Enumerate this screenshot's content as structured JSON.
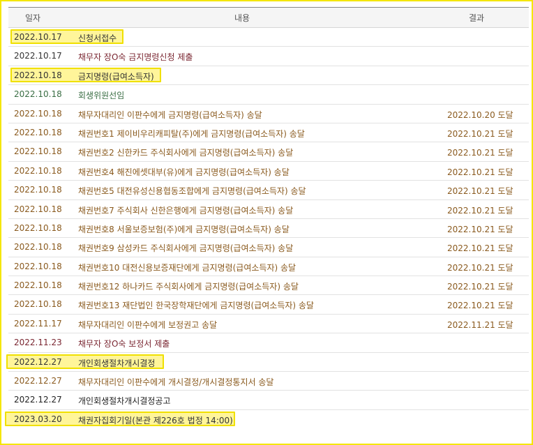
{
  "header": {
    "date": "일자",
    "content": "내용",
    "result": "결과"
  },
  "rows": [
    {
      "date": "2022.10.17",
      "content": "신청서접수",
      "result": ""
    },
    {
      "date": "2022.10.17",
      "content": "채무자 장O숙 금지명령신청 제출",
      "result": ""
    },
    {
      "date": "2022.10.18",
      "content": "금지명령(급여소득자)",
      "result": ""
    },
    {
      "date": "2022.10.18",
      "content": "회생위원선임",
      "result": ""
    },
    {
      "date": "2022.10.18",
      "content": "채무자대리인 이판수에게 금지명령(급여소득자) 송달",
      "result": "2022.10.20 도달"
    },
    {
      "date": "2022.10.18",
      "content": "채권번호1 제이비우리캐피탈(주)에게 금지명령(급여소득자) 송달",
      "result": "2022.10.21 도달"
    },
    {
      "date": "2022.10.18",
      "content": "채권번호2 신한카드 주식회사에게 금지명령(급여소득자) 송달",
      "result": "2022.10.21 도달"
    },
    {
      "date": "2022.10.18",
      "content": "채권번호4 해진에셋대부(유)에게 금지명령(급여소득자) 송달",
      "result": "2022.10.21 도달"
    },
    {
      "date": "2022.10.18",
      "content": "채권번호5 대전유성신용협동조합에게 금지명령(급여소득자) 송달",
      "result": "2022.10.21 도달"
    },
    {
      "date": "2022.10.18",
      "content": "채권번호7 주식회사 신한은행에게 금지명령(급여소득자) 송달",
      "result": "2022.10.21 도달"
    },
    {
      "date": "2022.10.18",
      "content": "채권번호8 서울보증보험(주)에게 금지명령(급여소득자) 송달",
      "result": "2022.10.21 도달"
    },
    {
      "date": "2022.10.18",
      "content": "채권번호9 삼성카드 주식회사에게 금지명령(급여소득자) 송달",
      "result": "2022.10.21 도달"
    },
    {
      "date": "2022.10.18",
      "content": "채권번호10 대전신용보증재단에게 금지명령(급여소득자) 송달",
      "result": "2022.10.21 도달"
    },
    {
      "date": "2022.10.18",
      "content": "채권번호12 하나카드 주식회사에게 금지명령(급여소득자) 송달",
      "result": "2022.10.21 도달"
    },
    {
      "date": "2022.10.18",
      "content": "채권번호13 재단법인 한국장학재단에게 금지명령(급여소득자) 송달",
      "result": "2022.10.21 도달"
    },
    {
      "date": "2022.11.17",
      "content": "채무자대리인 이판수에게 보정권고 송달",
      "result": "2022.11.21 도달"
    },
    {
      "date": "2022.11.23",
      "content": "채무자 장O숙 보정서 제출",
      "result": ""
    },
    {
      "date": "2022.12.27",
      "content": "개인회생절차개시결정",
      "result": ""
    },
    {
      "date": "2022.12.27",
      "content": "채무자대리인 이판수에게 개시결정/개시결정통지서 송달",
      "result": ""
    },
    {
      "date": "2022.12.27",
      "content": "개인회생절차개시결정공고",
      "result": ""
    },
    {
      "date": "2023.03.20",
      "content": "채권자집회기일(본관 제226호 법정 14:00)",
      "result": ""
    }
  ],
  "colors": {
    "highlight_fill": "#fff59a",
    "highlight_border": "#f0e000",
    "frame_border": "#f5e600",
    "delivery_text": "#8a5a1e",
    "submission_text": "#7a2631",
    "appointment_text": "#3a6e44"
  }
}
